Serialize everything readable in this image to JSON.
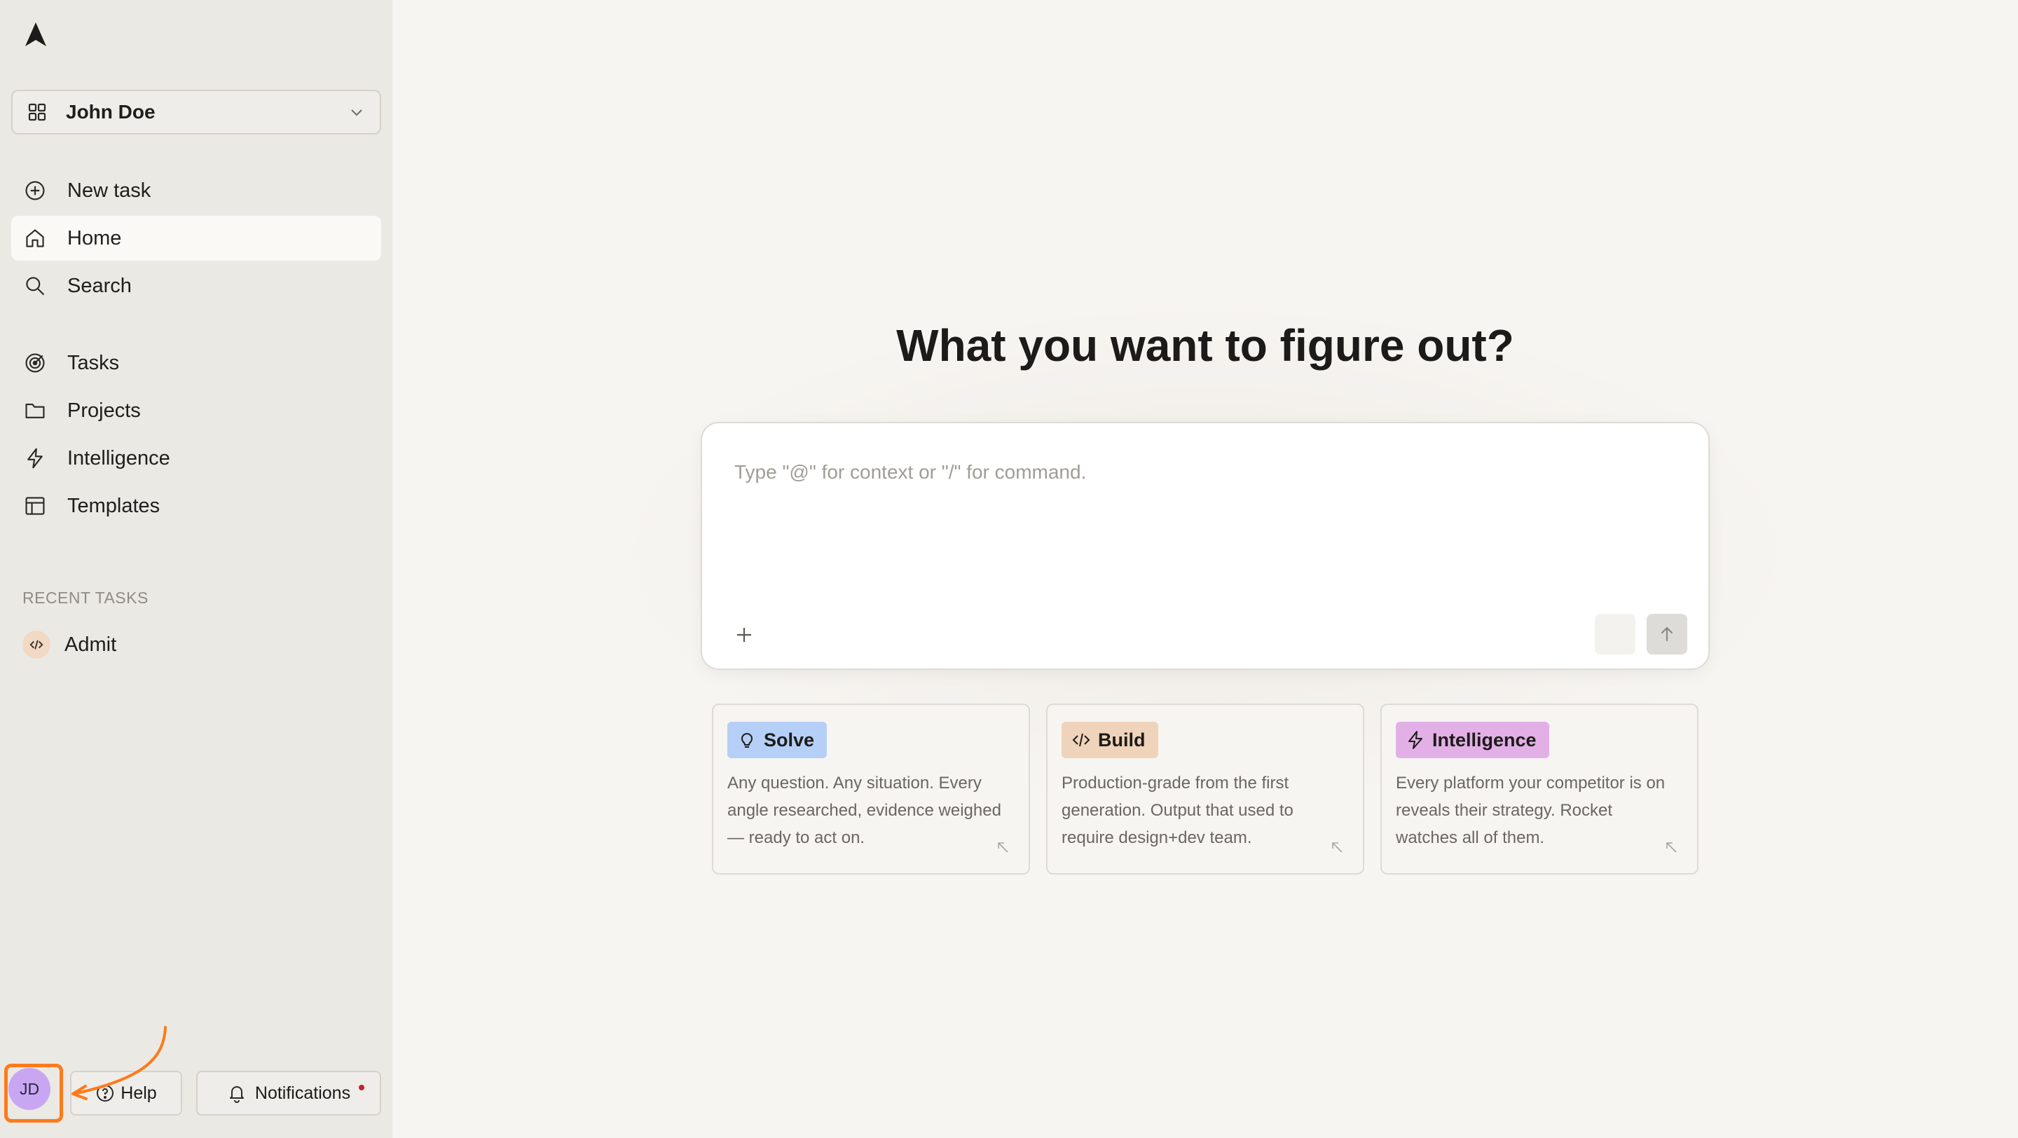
{
  "sidebar": {
    "logo": "rocket-logo",
    "workspace": {
      "name": "John Doe",
      "icon": "grid-icon"
    },
    "nav_primary": [
      {
        "label": "New task",
        "icon": "plus-circle-icon",
        "active": false
      },
      {
        "label": "Home",
        "icon": "home-icon",
        "active": true
      },
      {
        "label": "Search",
        "icon": "search-icon",
        "active": false
      }
    ],
    "nav_secondary": [
      {
        "label": "Tasks",
        "icon": "target-icon"
      },
      {
        "label": "Projects",
        "icon": "folder-icon"
      },
      {
        "label": "Intelligence",
        "icon": "bolt-icon"
      },
      {
        "label": "Templates",
        "icon": "layout-icon"
      }
    ],
    "recent_label": "RECENT TASKS",
    "recent_tasks": [
      {
        "label": "Admit",
        "icon": "code-icon"
      }
    ],
    "footer": {
      "avatar_initials": "JD",
      "help_label": "Help",
      "notifications_label": "Notifications"
    }
  },
  "main": {
    "headline": "What you want to figure out?",
    "composer": {
      "placeholder": "Type \"@\" for context or \"/\" for command.",
      "value": ""
    },
    "cards": [
      {
        "tag": "Solve",
        "icon": "lightbulb-icon",
        "color": "#b6cff7",
        "desc": "Any question. Any situation. Every angle researched, evidence weighed — ready to act on."
      },
      {
        "tag": "Build",
        "icon": "code-icon",
        "color": "#efd3ba",
        "desc": "Production-grade from the first generation. Output that used to require design+dev team."
      },
      {
        "tag": "Intelligence",
        "icon": "bolt-icon",
        "color": "#e2b0e6",
        "desc": "Every platform your competitor is on reveals their strategy. Rocket watches all of them."
      }
    ]
  },
  "colors": {
    "accent_annotation": "#ff7a1a",
    "sidebar_bg": "#ebe9e4",
    "main_bg": "#f7f5f1",
    "avatar_bg": "#c9a6f2",
    "notification_dot": "#c0242e"
  }
}
